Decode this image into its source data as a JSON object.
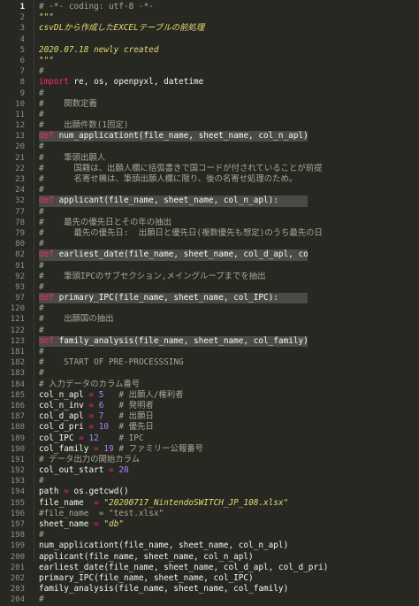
{
  "editor": {
    "lines": [
      {
        "n": "1",
        "active": true,
        "parts": [
          {
            "t": "# -*- coding: utf-8 -*-",
            "c": "c-comment"
          }
        ]
      },
      {
        "n": "2",
        "parts": [
          {
            "t": "\"\"\"",
            "c": "c-str"
          }
        ]
      },
      {
        "n": "3",
        "parts": [
          {
            "t": "csvDLから作成したEXCELテーブルの前処理",
            "c": "c-ja"
          }
        ]
      },
      {
        "n": "4",
        "parts": []
      },
      {
        "n": "5",
        "parts": [
          {
            "t": "2020.07.18 newly created",
            "c": "c-str"
          }
        ]
      },
      {
        "n": "6",
        "parts": [
          {
            "t": "\"\"\"",
            "c": "c-str"
          }
        ]
      },
      {
        "n": "7",
        "parts": [
          {
            "t": "#",
            "c": "c-comment"
          }
        ]
      },
      {
        "n": "8",
        "parts": [
          {
            "t": "import",
            "c": "c-kw"
          },
          {
            "t": " re, os, openpyxl, datetime",
            "c": "c-plain"
          }
        ]
      },
      {
        "n": "9",
        "parts": [
          {
            "t": "#",
            "c": "c-comment"
          }
        ]
      },
      {
        "n": "10",
        "parts": [
          {
            "t": "#    関数定義",
            "c": "c-comment"
          }
        ]
      },
      {
        "n": "11",
        "parts": [
          {
            "t": "#",
            "c": "c-comment"
          }
        ]
      },
      {
        "n": "12",
        "parts": [
          {
            "t": "#    出願件数(1固定)",
            "c": "c-comment"
          }
        ]
      },
      {
        "n": "13",
        "fold": true,
        "parts": [
          {
            "t": "def",
            "c": "c-kw"
          },
          {
            "t": " num_applicationt(file_name, sheet_name, col_n_apl):",
            "c": "c-plain"
          }
        ]
      },
      {
        "n": "20",
        "parts": [
          {
            "t": "#",
            "c": "c-comment"
          }
        ]
      },
      {
        "n": "21",
        "parts": [
          {
            "t": "#    筆頭出願人",
            "c": "c-comment"
          }
        ]
      },
      {
        "n": "22",
        "parts": [
          {
            "t": "#      国籍は、出願人欄に括弧書きで国コードが付されていることが前提",
            "c": "c-comment"
          }
        ]
      },
      {
        "n": "23",
        "parts": [
          {
            "t": "#      名寄せ機は、筆頭出願人欄に限り、後の名寄せ処理のため。",
            "c": "c-comment"
          }
        ]
      },
      {
        "n": "24",
        "parts": [
          {
            "t": "#",
            "c": "c-comment"
          }
        ]
      },
      {
        "n": "32",
        "fold": true,
        "parts": [
          {
            "t": "def",
            "c": "c-kw"
          },
          {
            "t": " applicant(file_name, sheet_name, col_n_apl):",
            "c": "c-plain"
          }
        ]
      },
      {
        "n": "77",
        "parts": [
          {
            "t": "#",
            "c": "c-comment"
          }
        ]
      },
      {
        "n": "78",
        "parts": [
          {
            "t": "#    最先の優先日とその年の抽出",
            "c": "c-comment"
          }
        ]
      },
      {
        "n": "79",
        "parts": [
          {
            "t": "#      最先の優先日:  出願日と優先日(複数優先も想定)のうち最先の日",
            "c": "c-comment"
          }
        ]
      },
      {
        "n": "80",
        "parts": [
          {
            "t": "#",
            "c": "c-comment"
          }
        ]
      },
      {
        "n": "82",
        "fold": true,
        "parts": [
          {
            "t": "def",
            "c": "c-kw"
          },
          {
            "t": " earliest_date(file_name, sheet_name, col_d_apl, col_d_pri):",
            "c": "c-plain"
          }
        ]
      },
      {
        "n": "91",
        "parts": [
          {
            "t": "#",
            "c": "c-comment"
          }
        ]
      },
      {
        "n": "92",
        "parts": [
          {
            "t": "#    筆頭IPCのサブセクション,メイングループまでを抽出",
            "c": "c-comment"
          }
        ]
      },
      {
        "n": "93",
        "parts": [
          {
            "t": "#",
            "c": "c-comment"
          }
        ]
      },
      {
        "n": "97",
        "fold": true,
        "parts": [
          {
            "t": "def",
            "c": "c-kw"
          },
          {
            "t": " primary_IPC(file_name, sheet_name, col_IPC):",
            "c": "c-plain"
          }
        ]
      },
      {
        "n": "120",
        "parts": [
          {
            "t": "#",
            "c": "c-comment"
          }
        ]
      },
      {
        "n": "121",
        "parts": [
          {
            "t": "#    出願国の抽出",
            "c": "c-comment"
          }
        ]
      },
      {
        "n": "122",
        "parts": [
          {
            "t": "#",
            "c": "c-comment"
          }
        ]
      },
      {
        "n": "123",
        "fold": true,
        "parts": [
          {
            "t": "def",
            "c": "c-kw"
          },
          {
            "t": " family_analysis(file_name, sheet_name, col_family):",
            "c": "c-plain"
          }
        ]
      },
      {
        "n": "181",
        "parts": [
          {
            "t": "#",
            "c": "c-comment"
          }
        ]
      },
      {
        "n": "182",
        "parts": [
          {
            "t": "#    START OF PRE-PROCESSSING",
            "c": "c-comment"
          }
        ]
      },
      {
        "n": "183",
        "parts": [
          {
            "t": "#",
            "c": "c-comment"
          }
        ]
      },
      {
        "n": "184",
        "parts": [
          {
            "t": "# 入力データのカラム番号",
            "c": "c-comment"
          }
        ]
      },
      {
        "n": "185",
        "parts": [
          {
            "t": "col_n_apl ",
            "c": "c-plain"
          },
          {
            "t": "=",
            "c": "c-op"
          },
          {
            "t": " ",
            "c": "c-plain"
          },
          {
            "t": "5",
            "c": "c-num"
          },
          {
            "t": "   # 出願人/権利者",
            "c": "c-comment"
          }
        ]
      },
      {
        "n": "186",
        "parts": [
          {
            "t": "col_n_inv ",
            "c": "c-plain"
          },
          {
            "t": "=",
            "c": "c-op"
          },
          {
            "t": " ",
            "c": "c-plain"
          },
          {
            "t": "6",
            "c": "c-num"
          },
          {
            "t": "   # 発明者",
            "c": "c-comment"
          }
        ]
      },
      {
        "n": "187",
        "parts": [
          {
            "t": "col_d_apl ",
            "c": "c-plain"
          },
          {
            "t": "=",
            "c": "c-op"
          },
          {
            "t": " ",
            "c": "c-plain"
          },
          {
            "t": "7",
            "c": "c-num"
          },
          {
            "t": "   # 出願日",
            "c": "c-comment"
          }
        ]
      },
      {
        "n": "188",
        "parts": [
          {
            "t": "col_d_pri ",
            "c": "c-plain"
          },
          {
            "t": "=",
            "c": "c-op"
          },
          {
            "t": " ",
            "c": "c-plain"
          },
          {
            "t": "10",
            "c": "c-num"
          },
          {
            "t": "  # 優先日",
            "c": "c-comment"
          }
        ]
      },
      {
        "n": "189",
        "parts": [
          {
            "t": "col_IPC ",
            "c": "c-plain"
          },
          {
            "t": "=",
            "c": "c-op"
          },
          {
            "t": " ",
            "c": "c-plain"
          },
          {
            "t": "12",
            "c": "c-num"
          },
          {
            "t": "    # IPC",
            "c": "c-comment"
          }
        ]
      },
      {
        "n": "190",
        "parts": [
          {
            "t": "col_family ",
            "c": "c-plain"
          },
          {
            "t": "=",
            "c": "c-op"
          },
          {
            "t": " ",
            "c": "c-plain"
          },
          {
            "t": "19",
            "c": "c-num"
          },
          {
            "t": " # ファミリー公報番号",
            "c": "c-comment"
          }
        ]
      },
      {
        "n": "191",
        "parts": [
          {
            "t": "# データ出力の開始カラム",
            "c": "c-comment"
          }
        ]
      },
      {
        "n": "192",
        "parts": [
          {
            "t": "col_out_start ",
            "c": "c-plain"
          },
          {
            "t": "=",
            "c": "c-op"
          },
          {
            "t": " ",
            "c": "c-plain"
          },
          {
            "t": "20",
            "c": "c-num"
          }
        ]
      },
      {
        "n": "193",
        "parts": [
          {
            "t": "#",
            "c": "c-comment"
          }
        ]
      },
      {
        "n": "194",
        "parts": [
          {
            "t": "path ",
            "c": "c-plain"
          },
          {
            "t": "=",
            "c": "c-op"
          },
          {
            "t": " os.getcwd()",
            "c": "c-plain"
          }
        ]
      },
      {
        "n": "195",
        "parts": [
          {
            "t": "file_name  ",
            "c": "c-plain"
          },
          {
            "t": "=",
            "c": "c-op"
          },
          {
            "t": " ",
            "c": "c-plain"
          },
          {
            "t": "\"20200717_NintendoSWITCH_JP_108.xlsx\"",
            "c": "c-str"
          }
        ]
      },
      {
        "n": "196",
        "parts": [
          {
            "t": "#file_name  = \"test.xlsx\"",
            "c": "c-comment"
          }
        ]
      },
      {
        "n": "197",
        "parts": [
          {
            "t": "sheet_name ",
            "c": "c-plain"
          },
          {
            "t": "=",
            "c": "c-op"
          },
          {
            "t": " ",
            "c": "c-plain"
          },
          {
            "t": "\"db\"",
            "c": "c-str"
          }
        ]
      },
      {
        "n": "198",
        "parts": [
          {
            "t": "#",
            "c": "c-comment"
          }
        ]
      },
      {
        "n": "199",
        "parts": [
          {
            "t": "num_applicationt(file_name, sheet_name, col_n_apl)",
            "c": "c-plain"
          }
        ]
      },
      {
        "n": "200",
        "parts": [
          {
            "t": "applicant(file_name, sheet_name, col_n_apl)",
            "c": "c-plain"
          }
        ]
      },
      {
        "n": "201",
        "parts": [
          {
            "t": "earliest_date(file_name, sheet_name, col_d_apl, col_d_pri)",
            "c": "c-plain"
          }
        ]
      },
      {
        "n": "202",
        "parts": [
          {
            "t": "primary_IPC(file_name, sheet_name, col_IPC)",
            "c": "c-plain"
          }
        ]
      },
      {
        "n": "203",
        "parts": [
          {
            "t": "family_analysis(file_name, sheet_name, col_family)",
            "c": "c-plain"
          }
        ]
      },
      {
        "n": "204",
        "parts": [
          {
            "t": "#",
            "c": "c-comment"
          }
        ]
      }
    ]
  }
}
